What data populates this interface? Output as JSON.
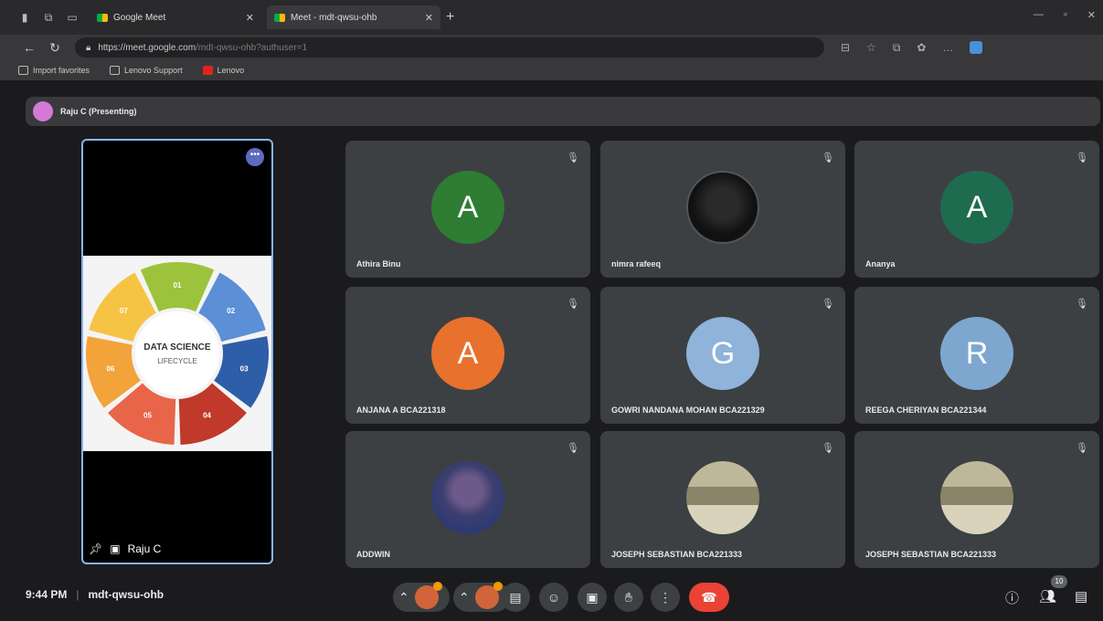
{
  "browser": {
    "tabs": [
      {
        "label": "Google Meet"
      },
      {
        "label": "Meet - mdt-qwsu-ohb"
      }
    ],
    "url_host": "https://meet.google.com",
    "url_path": "/mdt-qwsu-ohb?authuser=1",
    "favorites": [
      {
        "label": "Import favorites"
      },
      {
        "label": "Lenovo Support"
      },
      {
        "label": "Lenovo"
      }
    ]
  },
  "presenter_bar": {
    "label": "Raju C (Presenting)"
  },
  "presentation": {
    "presenter_name": "Raju C",
    "slide_title_line1": "DATA SCIENCE",
    "slide_title_line2": "LIFECYCLE",
    "segment_labels": [
      "01",
      "02",
      "03",
      "04",
      "05",
      "06",
      "07"
    ],
    "segment_colors": [
      "#9cc33b",
      "#5b8fd6",
      "#2f5ea8",
      "#c0392b",
      "#e8654a",
      "#f2a33a",
      "#f6c445"
    ]
  },
  "participants": [
    {
      "name": "Athira Binu",
      "initial": "A",
      "color": "#2e7d32",
      "avatar": "letter"
    },
    {
      "name": "nimra rafeeq",
      "initial": "",
      "color": "",
      "avatar": "photo-dark"
    },
    {
      "name": "Ananya",
      "initial": "A",
      "color": "#1e6b4f",
      "avatar": "letter"
    },
    {
      "name": "ANJANA A BCA221318",
      "initial": "A",
      "color": "#e8712e",
      "avatar": "letter"
    },
    {
      "name": "GOWRI NANDANA MOHAN BCA221329",
      "initial": "G",
      "color": "#8fb3d9",
      "avatar": "letter"
    },
    {
      "name": "REEGA CHERIYAN BCA221344",
      "initial": "R",
      "color": "#7ea7cf",
      "avatar": "letter"
    },
    {
      "name": "ADDWIN",
      "initial": "",
      "color": "",
      "avatar": "cartoon"
    },
    {
      "name": "JOSEPH SEBASTIAN BCA221333",
      "initial": "",
      "color": "",
      "avatar": "group"
    },
    {
      "name": "JOSEPH SEBASTIAN BCA221333",
      "initial": "",
      "color": "",
      "avatar": "group"
    }
  ],
  "bottom": {
    "time": "9:44 PM",
    "meeting_code": "mdt-qwsu-ohb",
    "people_count": "10"
  },
  "icons": {
    "mic": "muted-mic-icon",
    "captions": "captions-icon",
    "emoji": "emoji-icon",
    "present": "present-screen-icon",
    "hand": "raise-hand-icon",
    "more": "more-options-icon",
    "end": "end-call-icon",
    "info": "info-icon",
    "people": "people-icon",
    "chat": "chat-icon"
  }
}
